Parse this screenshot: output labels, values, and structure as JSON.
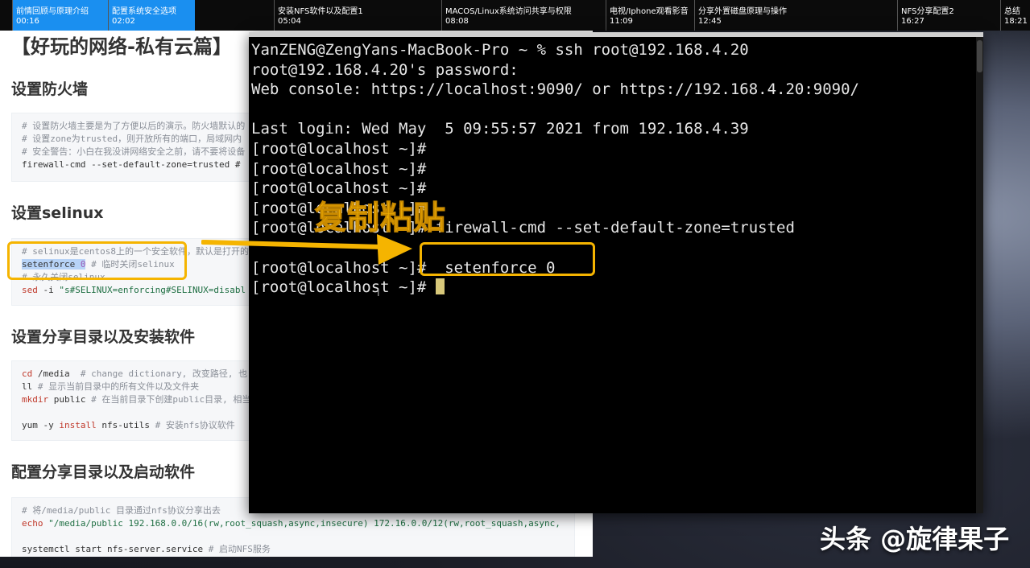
{
  "timeline": {
    "segments": [
      {
        "title": "前情回顾与原理介绍",
        "time": "00:16",
        "active": true
      },
      {
        "title": "配置系统安全选项",
        "time": "02:02",
        "active": true
      },
      {
        "title": "安装NFS软件以及配置1",
        "time": "05:04",
        "active": false
      },
      {
        "title": "MACOS/Linux系统访问共享与权限",
        "time": "08:08",
        "active": false
      },
      {
        "title": "电视/Iphone观看影音",
        "time": "11:09",
        "active": false
      },
      {
        "title": "分享外置磁盘原理与操作",
        "time": "12:45",
        "active": false
      },
      {
        "title": "NFS分享配置2",
        "time": "16:27",
        "active": false
      },
      {
        "title": "总结",
        "time": "18:21",
        "active": false
      }
    ]
  },
  "doc": {
    "title": "【好玩的网络-私有云篇】",
    "sections": [
      {
        "heading": "设置防火墙"
      },
      {
        "heading": "设置selinux"
      },
      {
        "heading": "设置分享目录以及安装软件"
      },
      {
        "heading": "配置分享目录以及启动软件"
      }
    ],
    "firewall_lines": [
      "# 设置防火墙主要是为了方便以后的演示。防火墙默认的",
      "# 设置zone为trusted，则开放所有的端口，局域网内",
      "# 安全警告：小白在我没讲网络安全之前，请不要将设备",
      "firewall-cmd --set-default-zone=trusted #"
    ],
    "selinux_lines": {
      "comment1": "# selinux是centos8上的一个安全软件，默认是打开的",
      "cmd": "setenforce ",
      "cmd_num": "0",
      "cmd_comment": " # 临时关闭selinux",
      "comment2": "# 永久关闭selinux",
      "sed_kw": "sed",
      "sed_rest": " -i ",
      "sed_str": "\"s#SELINUX=enforcing#SELINUX=disabl"
    },
    "share_lines": {
      "cd_kw": "cd",
      "cd_rest": " /media  ",
      "cd_cm": "# change dictionary, 改变路径, 也",
      "ll": "ll",
      "ll_cm": " # 显示当前目录中的所有文件以及文件夹",
      "mkdir_kw": "mkdir",
      "mkdir_rest": " public ",
      "mkdir_cm": "# 在当前目录下创建public目录, 相当",
      "yum_a": "yum -y ",
      "yum_kw": "install",
      "yum_b": " nfs-utils ",
      "yum_cm": "# 安装nfs协议软件"
    },
    "config_lines": {
      "cm1": "# 将/media/public 目录通过nfs协议分享出去",
      "echo_kw": "echo",
      "echo_str": " \"/media/public 192.168.0.0/16(rw,root_squash,async,insecure) 172.16.0.0/12(rw,root_squash,async,",
      "systemctl": "systemctl start nfs-server.service ",
      "systemctl_cm": "# 启动NFS服务"
    }
  },
  "terminal": {
    "lines": [
      "YanZENG@ZengYans-MacBook-Pro ~ % ssh root@192.168.4.20",
      "root@192.168.4.20's password:",
      "Web console: https://localhost:9090/ or https://192.168.4.20:9090/",
      "",
      "Last login: Wed May  5 09:55:57 2021 from 192.168.4.39",
      "[root@localhost ~]#",
      "[root@localhost ~]#",
      "[root@localhost ~]#",
      "[root@localhost ~]#",
      "[root@localhost ~]# firewall-cmd --set-default-zone=trusted",
      "",
      "[root@localhost ~]#  setenforce 0",
      "[root@localhost ~]# "
    ]
  },
  "annotation": {
    "label": "复制粘贴",
    "color": "#f5b400"
  },
  "watermark": "头条 @旋律果子"
}
